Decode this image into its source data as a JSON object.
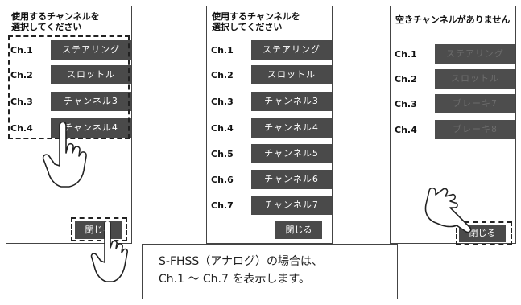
{
  "panel1": {
    "title": "使用するチャンネルを\n選択してください",
    "channels": [
      {
        "label": "Ch.1",
        "button": "ステアリング"
      },
      {
        "label": "Ch.2",
        "button": "スロットル"
      },
      {
        "label": "Ch.3",
        "button": "チャンネル3"
      },
      {
        "label": "Ch.4",
        "button": "チャンネル4"
      }
    ],
    "close_label": "閉じる"
  },
  "panel2": {
    "title": "使用するチャンネルを\n選択してください",
    "channels": [
      {
        "label": "Ch.1",
        "button": "ステアリング"
      },
      {
        "label": "Ch.2",
        "button": "スロットル"
      },
      {
        "label": "Ch.3",
        "button": "チャンネル3"
      },
      {
        "label": "Ch.4",
        "button": "チャンネル4"
      },
      {
        "label": "Ch.5",
        "button": "チャンネル5"
      },
      {
        "label": "Ch.6",
        "button": "チャンネル6"
      },
      {
        "label": "Ch.7",
        "button": "チャンネル7"
      }
    ],
    "close_label": "閉じる"
  },
  "panel3": {
    "title": "空きチャンネルがありません",
    "channels": [
      {
        "label": "Ch.1",
        "button": "ステアリング"
      },
      {
        "label": "Ch.2",
        "button": "スロットル"
      },
      {
        "label": "Ch.3",
        "button": "ブレーキ7"
      },
      {
        "label": "Ch.4",
        "button": "ブレーキ8"
      }
    ],
    "close_label": "閉じる"
  },
  "note": {
    "text": "S-FHSS（アナログ）の場合は、\nCh.1 ～ Ch.7 を表示します。"
  }
}
